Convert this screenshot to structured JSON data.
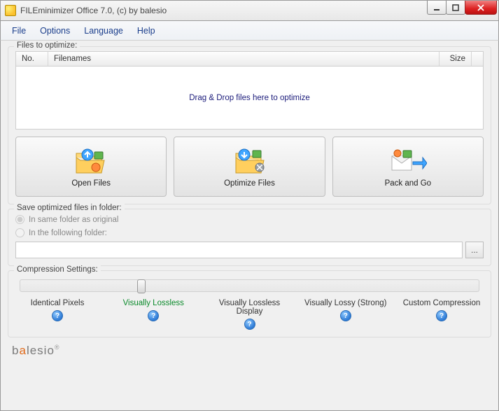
{
  "window": {
    "title": "FILEminimizer Office 7.0, (c) by balesio"
  },
  "menu": {
    "file": "File",
    "options": "Options",
    "language": "Language",
    "help": "Help"
  },
  "files": {
    "legend": "Files to optimize:",
    "col_no": "No.",
    "col_filenames": "Filenames",
    "col_size": "Size",
    "empty_hint": "Drag & Drop files here to optimize"
  },
  "buttons": {
    "open": "Open Files",
    "optimize": "Optimize Files",
    "pack": "Pack and Go"
  },
  "save": {
    "legend": "Save optimized files in folder:",
    "radio_same": "In same folder as original",
    "radio_following": "In the following folder:",
    "path_value": "",
    "browse_label": "..."
  },
  "compression": {
    "legend": "Compression Settings:",
    "labels": {
      "identical": "Identical Pixels",
      "lossless": "Visually Lossless",
      "lossless_display": "Visually Lossless Display",
      "lossy_strong": "Visually Lossy (Strong)",
      "custom": "Custom Compression"
    },
    "selected_index": 1
  },
  "footer": {
    "brand_pre": "b",
    "brand_accent": "a",
    "brand_post": "lesio"
  }
}
